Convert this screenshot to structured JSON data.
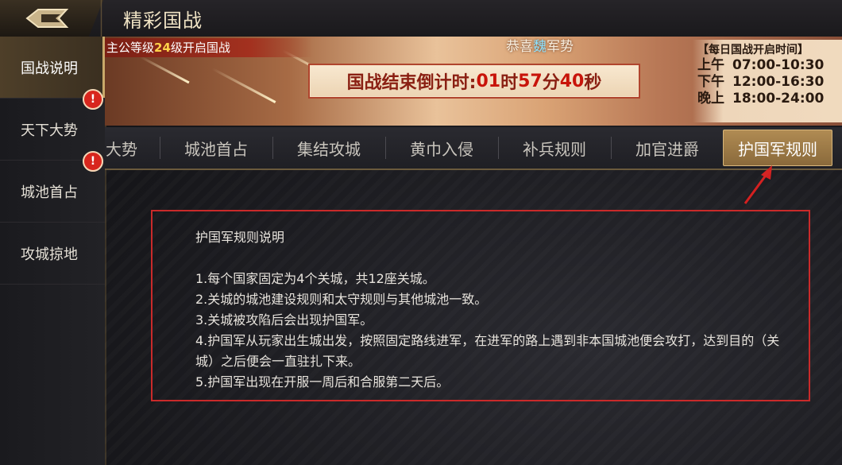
{
  "header": {
    "title": "精彩国战"
  },
  "sidebar": {
    "items": [
      {
        "label": "国战说明",
        "active": true,
        "badge": ""
      },
      {
        "label": "天下大势",
        "active": false,
        "badge": "!"
      },
      {
        "label": "城池首占",
        "active": false,
        "badge": "!"
      },
      {
        "label": "攻城掠地",
        "active": false,
        "badge": ""
      }
    ]
  },
  "banner": {
    "ribbon_prefix": "主公等级",
    "ribbon_level": "24",
    "ribbon_suffix": "级开启国战",
    "congrats_prefix": "恭喜",
    "congrats_nation": "魏",
    "congrats_suffix": "军势",
    "countdown_label": "国战结束倒计时:",
    "countdown_h": "01",
    "countdown_h_unit": "时",
    "countdown_m": "57",
    "countdown_m_unit": "分",
    "countdown_s": "40",
    "countdown_s_unit": "秒",
    "schedule_title": "【每日国战开启时间】",
    "schedule": [
      {
        "period": "上午",
        "time": "07:00-10:30"
      },
      {
        "period": "下午",
        "time": "12:00-16:30"
      },
      {
        "period": "晚上",
        "time": "18:00-24:00"
      }
    ]
  },
  "tabs": [
    {
      "label": "大势",
      "active": false
    },
    {
      "label": "城池首占",
      "active": false
    },
    {
      "label": "集结攻城",
      "active": false
    },
    {
      "label": "黄巾入侵",
      "active": false
    },
    {
      "label": "补兵规则",
      "active": false
    },
    {
      "label": "加官进爵",
      "active": false
    },
    {
      "label": "护国军规则",
      "active": true
    }
  ],
  "rules": {
    "heading": "护国军规则说明",
    "lines": [
      "1.每个国家固定为4个关城，共12座关城。",
      "2.关城的城池建设规则和太守规则与其他城池一致。",
      "3.关城被攻陷后会出现护国军。",
      "4.护国军从玩家出生城出发，按照固定路线进军，在进军的路上遇到非本国城池便会攻打，达到目的（关城）之后便会一直驻扎下来。",
      "5.护国军出现在开服一周后和合服第二天后。"
    ]
  },
  "colors": {
    "accent": "#c92a2a",
    "gold": "#b08b53",
    "countdown": "#c8140a"
  }
}
